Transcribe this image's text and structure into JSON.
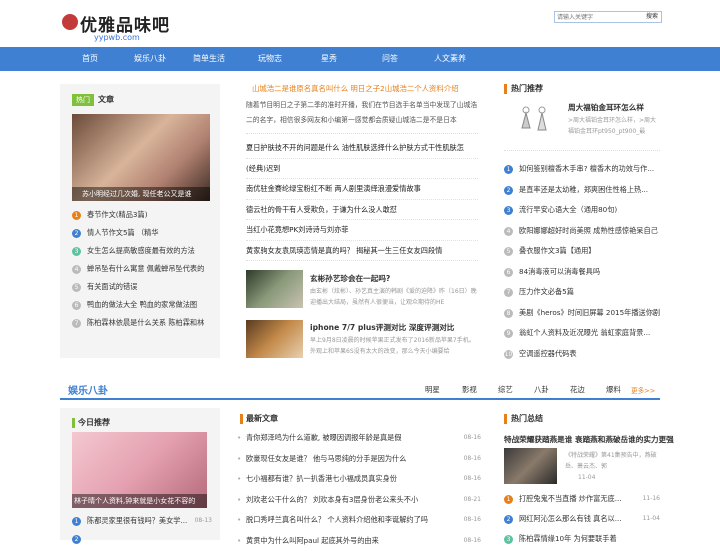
{
  "header": {
    "logo_text": "优雅品味吧",
    "logo_sub": "yypwb.com",
    "search_placeholder": "请输入关键字",
    "search_button": "搜索"
  },
  "nav": [
    "首页",
    "娱乐八卦",
    "简单生活",
    "玩物志",
    "星秀",
    "问答",
    "人文素养"
  ],
  "hot": {
    "tag": "热门",
    "title": "文章",
    "caption": "苏小明经过几次婚, 现任老公又是谁",
    "items": [
      {
        "num": "1",
        "text": "春节作文(精品3篇)"
      },
      {
        "num": "2",
        "text": "情人节作文5篇 （精华"
      },
      {
        "num": "3",
        "text": "女生怎么提高敏感度最有效的方法"
      },
      {
        "num": "4",
        "text": "蝉吊坠有什么寓意 佩戴蝉吊坠代表的"
      },
      {
        "num": "5",
        "text": "有关面试的错误"
      },
      {
        "num": "6",
        "text": "鸭血的做法大全 鸭血的家常做法图"
      },
      {
        "num": "7",
        "text": "陈柏霖林依晨是什么关系 陈柏霖和林"
      }
    ]
  },
  "main": {
    "headline": "山城浩二是谁原名真名叫什么 明日之子2山城浩二个人资料介绍",
    "summary": "随着节目明日之子第二季的准时开播，我们在节目选手名单当中发现了山城浩二的名字，相信很多网友和小编第一感觉都会质疑山城浩二是不是日本",
    "list": [
      "夏日护肤技不开的问题是什么 油性肌肤选择什么护肤方式干性肌肤怎",
      "(经典)迟到",
      "南优驻金賽纶绿宝粉红不断 两人剧里演绎浪漫爱情故事",
      "德云社的骨干有人受欺负，于谦为什么没人敢怼",
      "当红小花竟想PK刘诗诗与刘亦菲",
      "黄家驹女友袁凤瑛恋情是真的吗？ 揭秘其一生三任女友四段情"
    ],
    "thumbs": [
      {
        "title": "玄彬孙艺珍会在一起吗?",
        "desc": "由玄彬（炫彬）、孙艺真主演的韩剧《爱的迫降》昨（16日）晚迎播出大结局，虽然有人很便当，让观众期待的HE"
      },
      {
        "title": "iphone 7/7 plus评测对比 深度评测对比",
        "desc": "早上9月8日凌晨的时候苹果正式发布了2016新品苹果7手机。外观上和苹果6S没有太大的改变，那么今天小编要给"
      }
    ]
  },
  "right": {
    "title": "热门推荐",
    "feature_title": "周大福铂金耳环怎么样",
    "feature_desc": ">周大福铂金耳环怎么样，>周大福铂金耳环pt950_pt900_最",
    "items": [
      {
        "num": "1",
        "text": "如何鉴别檀香木手串? 檀香木的功效与作..."
      },
      {
        "num": "2",
        "text": "是直率还是太幼稚，郑爽困住性格上热..."
      },
      {
        "num": "3",
        "text": "流行早安心语大全（通用80句)"
      },
      {
        "num": "4",
        "text": "欧阳娜娜超好时尚美照 成熟性感惊艳呆自己"
      },
      {
        "num": "5",
        "text": "叠衣服作文3篇【通用】"
      },
      {
        "num": "6",
        "text": "84消毒液可以消毒餐具吗"
      },
      {
        "num": "7",
        "text": "压力作文必备5篇"
      },
      {
        "num": "8",
        "text": "美剧《heros》时间旧屏幕 2015年播送你剧"
      },
      {
        "num": "9",
        "text": "翁虹个人资料及近况曝光 翁虹家庭背景..."
      },
      {
        "num": "10",
        "text": "空调遥控器代码表"
      }
    ]
  },
  "ent": {
    "title": "娱乐八卦",
    "tabs": [
      "明星",
      "影视",
      "综艺",
      "八卦",
      "花边",
      "爆料"
    ],
    "more": "更多>>",
    "today_title": "今日推荐",
    "today_caption": "林子晴个人资料,钟来就是小女花不容的",
    "today_items": [
      {
        "num": "1",
        "text": "陈都灵家里很有钱吗？美女学...",
        "date": "08-13"
      },
      {
        "num": "2",
        "text": "",
        "date": ""
      }
    ],
    "latest_title": "最新文章",
    "latest": [
      {
        "text": "青你郑泽鸣为什么道歉, 被曝因调报年龄是真是假",
        "date": "08-16"
      },
      {
        "text": "欧豪现任女友是谁？ 他与马思纯的分手是因为什么",
        "date": "08-16"
      },
      {
        "text": "七小福都有谁？扒一扒香港七小福成员真实身份",
        "date": "08-16"
      },
      {
        "text": "刘欢老公干什么的？ 刘欢本身有3层身份老公来头不小",
        "date": "08-21"
      },
      {
        "text": "脱口秀呼兰真名叫什么？ 个人资料介绍他和李诞解约了吗",
        "date": "08-16"
      },
      {
        "text": "黄贯中为什么叫阿paul 起底其外号的由来",
        "date": "08-16"
      }
    ],
    "summary_title": "热门总结",
    "summary_head": "特战荣耀获踏燕是谁 衰踏燕和燕破岳谁的实力更强",
    "summary_desc": "《特战荣耀》第41集预告中，燕破岳、萧云杰、郭",
    "summary_date": "11-04",
    "summary_items": [
      {
        "num": "1",
        "text": "打腔兔鬼不当直播 炒作富无底...",
        "date": "11-16"
      },
      {
        "num": "2",
        "text": "网红阿沁怎么那么有钱 真名以...",
        "date": "11-04"
      },
      {
        "num": "3",
        "text": "陈柏霖情缘10年 为何要联手着",
        "date": ""
      }
    ]
  },
  "colors": {
    "nav": "#3f80d2",
    "accent": "#e8801a",
    "green": "#80c03a"
  }
}
